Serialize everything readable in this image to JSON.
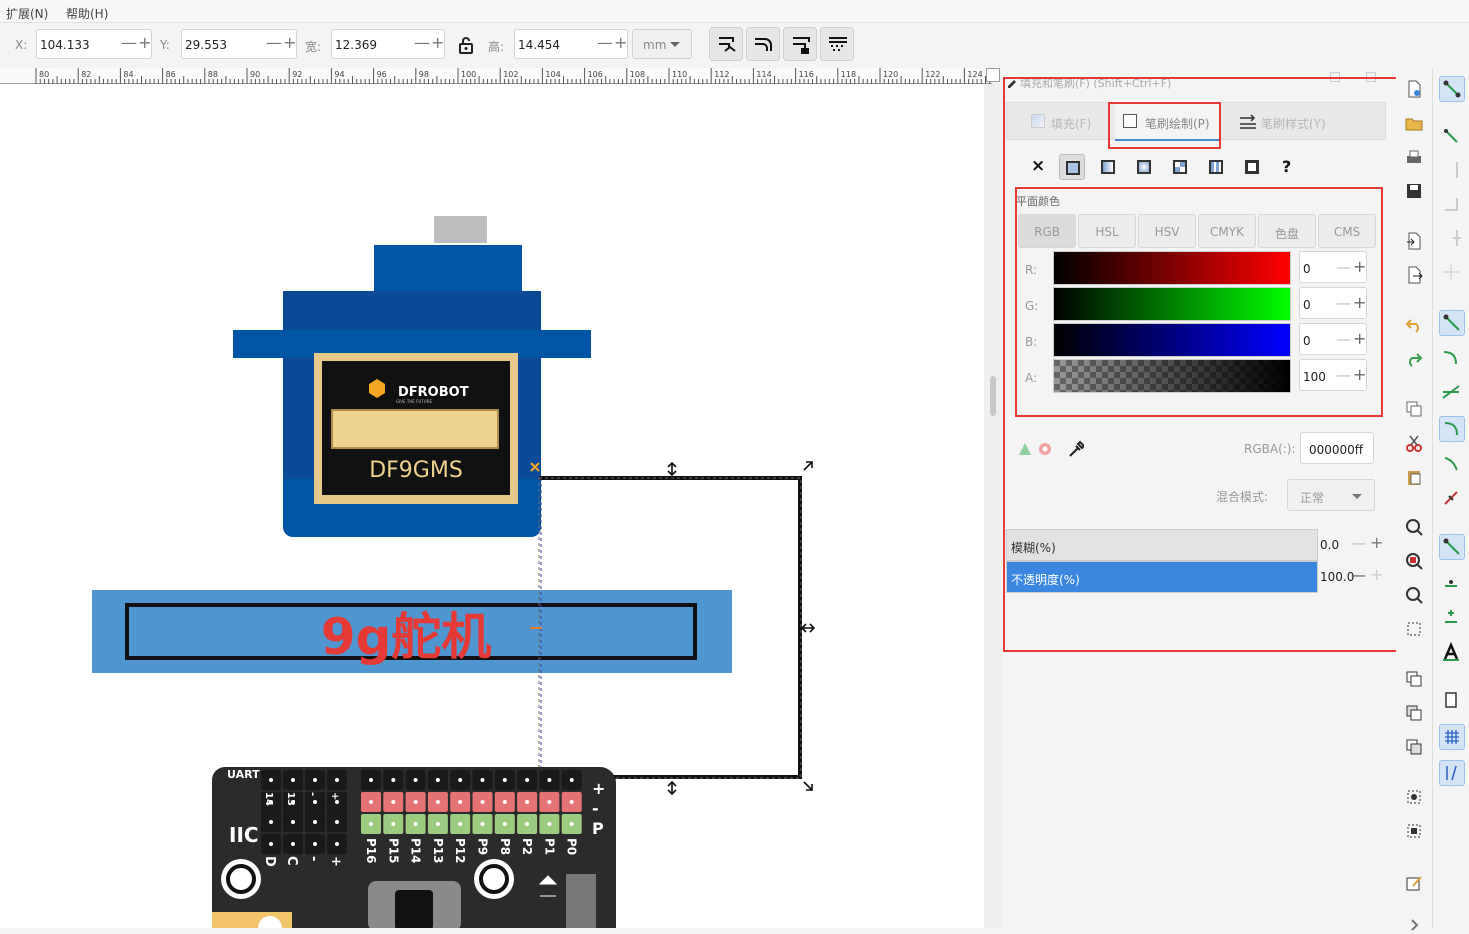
{
  "menubar": {
    "items": [
      "扩展(N)",
      "帮助(H)"
    ]
  },
  "toolbar": {
    "x_label": "X:",
    "x_value": "104.133",
    "y_label": "Y:",
    "y_value": "29.553",
    "w_label": "宽:",
    "w_value": "12.369",
    "h_label": "高:",
    "h_value": "14.454",
    "unit": "mm",
    "minus": "—",
    "plus": "+"
  },
  "ruler": {
    "ticks": [
      "80",
      "82",
      "84",
      "86",
      "88",
      "90",
      "92",
      "94",
      "96",
      "98",
      "100",
      "102",
      "104",
      "106",
      "108",
      "110",
      "112",
      "114",
      "116",
      "118",
      "120",
      "122",
      "124"
    ]
  },
  "canvas": {
    "servo_brand": "DFROBOT",
    "servo_tagline": "GIVE THE FUTURE",
    "servo_model": "DF9GMS",
    "label_text": "9g舵机",
    "board": {
      "uart": "UART",
      "iic": "IIC",
      "uart_pins": [
        "14",
        "13",
        "-",
        "+"
      ],
      "iic_pins": [
        "D",
        "C",
        "-",
        "+"
      ],
      "side_pins": [
        "+",
        "-",
        "P"
      ],
      "pins": [
        "P16",
        "P15",
        "P14",
        "P13",
        "P12",
        "P9",
        "P8",
        "P2",
        "P1",
        "P0"
      ]
    }
  },
  "panel": {
    "title": "填充和笔刷(F) (Shift+Ctrl+F)",
    "tabs": [
      {
        "label": "填充(F)",
        "active": false
      },
      {
        "label": "笔刷绘制(P)",
        "active": true
      },
      {
        "label": "笔刷样式(Y)",
        "active": false
      }
    ],
    "paint_help": "?",
    "paint_none": "×",
    "section_label": "平面颜色",
    "modes": [
      "RGB",
      "HSL",
      "HSV",
      "CMYK",
      "色盘",
      "CMS"
    ],
    "channels": [
      {
        "label": "R:",
        "value": "0"
      },
      {
        "label": "G:",
        "value": "0"
      },
      {
        "label": "B:",
        "value": "0"
      },
      {
        "label": "A:",
        "value": "100"
      }
    ],
    "rgba_label": "RGBA(:):",
    "rgba_value": "000000ff",
    "blend_label": "混合模式:",
    "blend_value": "正常",
    "blur_label": "模糊(%)",
    "blur_value": "0.0",
    "opacity_label": "不透明度(%)",
    "opacity_value": "100.0",
    "opacity_percent": 100
  },
  "colors": {
    "accent": "#3a86e0",
    "highlight": "#e53935",
    "servo_blue": "#0055a5",
    "label_bg": "#4f95cf"
  }
}
